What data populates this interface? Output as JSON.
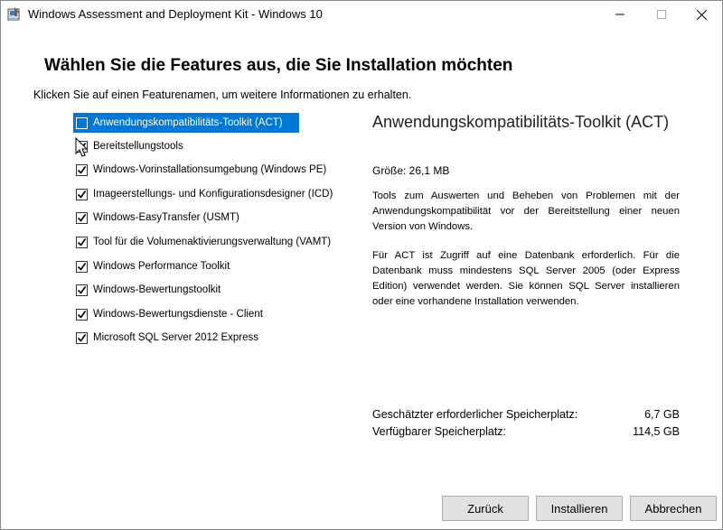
{
  "window": {
    "title": "Windows Assessment and Deployment Kit - Windows 10"
  },
  "page": {
    "heading": "Wählen Sie die Features aus, die Sie Installation möchten",
    "subtitle": "Klicken Sie auf einen Featurenamen, um weitere Informationen zu erhalten."
  },
  "features": [
    {
      "label": "Anwendungskompatibilitäts-Toolkit (ACT)",
      "checked": false,
      "selected": true
    },
    {
      "label": "Bereitstellungstools",
      "checked": true,
      "selected": false
    },
    {
      "label": "Windows-Vorinstallationsumgebung (Windows PE)",
      "checked": true,
      "selected": false
    },
    {
      "label": "Imageerstellungs- und Konfigurationsdesigner (ICD)",
      "checked": true,
      "selected": false
    },
    {
      "label": "Windows-EasyTransfer (USMT)",
      "checked": true,
      "selected": false
    },
    {
      "label": "Tool für die Volumenaktivierungsverwaltung (VAMT)",
      "checked": true,
      "selected": false
    },
    {
      "label": "Windows Performance Toolkit",
      "checked": true,
      "selected": false
    },
    {
      "label": "Windows-Bewertungstoolkit",
      "checked": true,
      "selected": false
    },
    {
      "label": "Windows-Bewertungsdienste - Client",
      "checked": true,
      "selected": false
    },
    {
      "label": "Microsoft SQL Server 2012 Express",
      "checked": true,
      "selected": false
    }
  ],
  "details": {
    "title": "Anwendungskompatibilitäts-Toolkit (ACT)",
    "size": "Größe: 26,1 MB",
    "description_1": "Tools zum Auswerten und Beheben von Problemen mit der Anwendungskompatibilität vor der Bereitstellung einer neuen Version von Windows.",
    "description_2": "Für ACT ist Zugriff auf eine Datenbank erforderlich. Für die Datenbank muss mindestens SQL Server 2005 (oder Express Edition) verwendet werden. Sie können SQL Server installieren oder eine vorhandene Installation verwenden."
  },
  "storage": {
    "required_label": "Geschätzter erforderlicher Speicherplatz:",
    "required_value": "6,7 GB",
    "available_label": "Verfügbarer Speicherplatz:",
    "available_value": "114,5 GB"
  },
  "buttons": {
    "back": "Zurück",
    "install": "Installieren",
    "cancel": "Abbrechen"
  },
  "colors": {
    "selection": "#0078d7",
    "button_bg": "#e1e1e1"
  }
}
